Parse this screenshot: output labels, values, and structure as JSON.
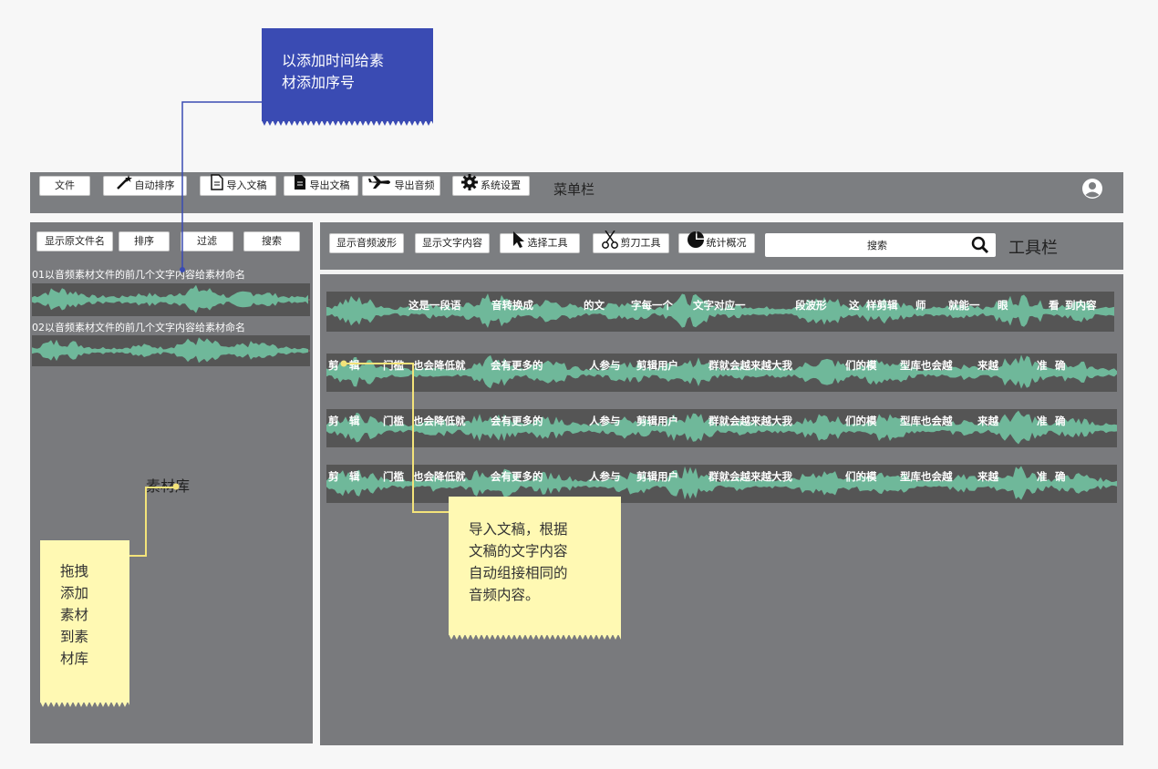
{
  "menubar": {
    "items": [
      "文件",
      "自动排序",
      "导入文稿",
      "导出文稿",
      "导出音频",
      "系统设置"
    ],
    "label": "菜单栏"
  },
  "left_panel": {
    "buttons": [
      "显示原文件名",
      "排序",
      "过滤",
      "搜索"
    ],
    "clips": [
      "01以音频素材文件的前几个文字内容给素材命名",
      "02以音频素材文件的前几个文字内容给素材命名"
    ],
    "label": "素材库"
  },
  "toolbar": {
    "buttons": [
      "显示音频波形",
      "显示文字内容",
      "选择工具",
      "剪刀工具",
      "统计概况"
    ],
    "search_label": "搜索",
    "label": "工具栏"
  },
  "tracks": {
    "track1": [
      "这是一段语",
      "音转换成",
      "的文",
      "字每一个",
      "文字对应一",
      "段波形",
      "这",
      "样剪辑",
      "师",
      "就能一",
      "眼",
      "看",
      "到内容"
    ],
    "track_repeat": [
      "剪",
      "辑",
      "门槛",
      "也会降低就",
      "会有更多的",
      "人参与",
      "剪辑用户",
      "群就会越来越大我",
      "们的模",
      "型库也会越",
      "来越",
      "准",
      "确"
    ]
  },
  "notes": {
    "blue": "以添加时间给素材添加序号",
    "blue_lines": [
      "以添加时间给素",
      "材添加序号"
    ],
    "left_lines": [
      "拖拽",
      "添加",
      "素材",
      "到素",
      "材库"
    ],
    "right_lines": [
      "导入文稿，根据",
      "文稿的文字内容",
      "自动组接相同的",
      "音频内容。"
    ]
  },
  "colors": {
    "panel": "#797a7d",
    "wave": "#6fb89a",
    "note_blue": "#3a4bb3",
    "note_yellow": "#fff9b3",
    "connector": "#f3e37a"
  }
}
